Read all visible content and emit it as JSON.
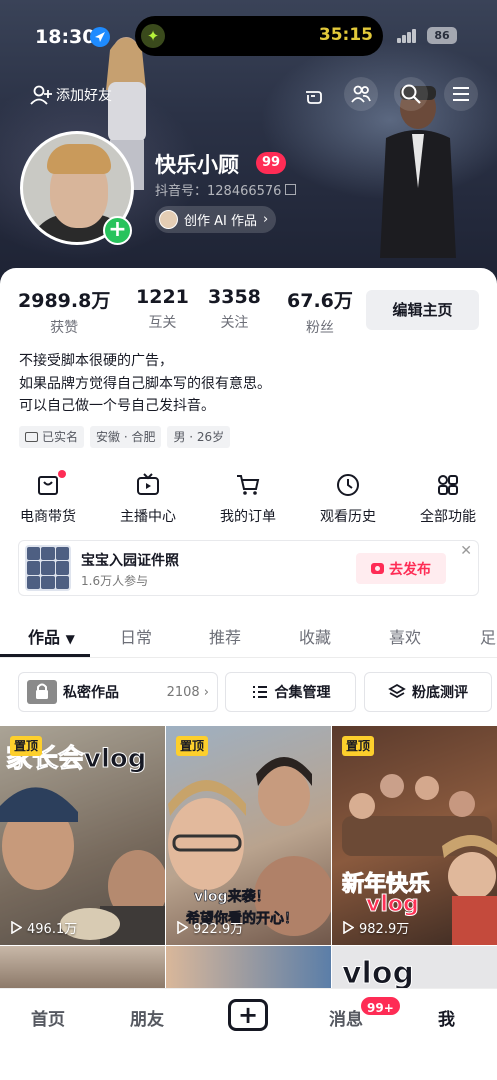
{
  "status_bar": {
    "time": "18:30",
    "activity_timer": "35:15",
    "battery": "86"
  },
  "top_nav": {
    "add_friend": "添加好友"
  },
  "profile": {
    "nickname": "快乐小顾",
    "level": "99",
    "douyin_id": "抖音号：128466576",
    "ai_chip": "创作 AI 作品"
  },
  "stats": [
    {
      "value": "2989.8万",
      "label": "获赞"
    },
    {
      "value": "1221",
      "label": "互关"
    },
    {
      "value": "3358",
      "label": "关注"
    },
    {
      "value": "67.6万",
      "label": "粉丝"
    }
  ],
  "edit_profile": "编辑主页",
  "bio": [
    "不接受脚本很硬的广告，",
    "如果品牌方觉得自己脚本写的很有意思。",
    "可以自己做一个号自己发抖音。"
  ],
  "tags": [
    "已实名",
    "安徽 · 合肥",
    "男 · 26岁"
  ],
  "functions": [
    {
      "label": "电商带货",
      "icon": "shopping-bag-icon"
    },
    {
      "label": "主播中心",
      "icon": "tv-play-icon"
    },
    {
      "label": "我的订单",
      "icon": "cart-icon"
    },
    {
      "label": "观看历史",
      "icon": "clock-icon"
    },
    {
      "label": "全部功能",
      "icon": "grid-icon"
    }
  ],
  "banner": {
    "title": "宝宝入园证件照",
    "subtitle": "1.6万人参与",
    "button": "去发布"
  },
  "tabs": [
    "作品",
    "日常",
    "推荐",
    "收藏",
    "喜欢",
    "足"
  ],
  "collections": {
    "private_label": "私密作品",
    "private_count": "2108",
    "collection_label": "合集管理",
    "fan_review_label": "粉底测评"
  },
  "videos": [
    {
      "pinned": "置顶",
      "caption": "家长会vlog",
      "plays": "496.1万"
    },
    {
      "pinned": "置顶",
      "caption": "vlog来袭！",
      "caption2": "希望你看的开心！",
      "plays": "922.9万"
    },
    {
      "pinned": "置顶",
      "caption": "新年快乐",
      "caption2": "vlog",
      "plays": "982.9万"
    },
    {
      "caption": "vlog"
    }
  ],
  "bottom_nav": {
    "home": "首页",
    "friends": "朋友",
    "messages": "消息",
    "messages_badge": "99+",
    "me": "我"
  },
  "colors": {
    "accent": "#fe2c55",
    "pin": "#fdcf2c",
    "online": "#28c35c"
  }
}
